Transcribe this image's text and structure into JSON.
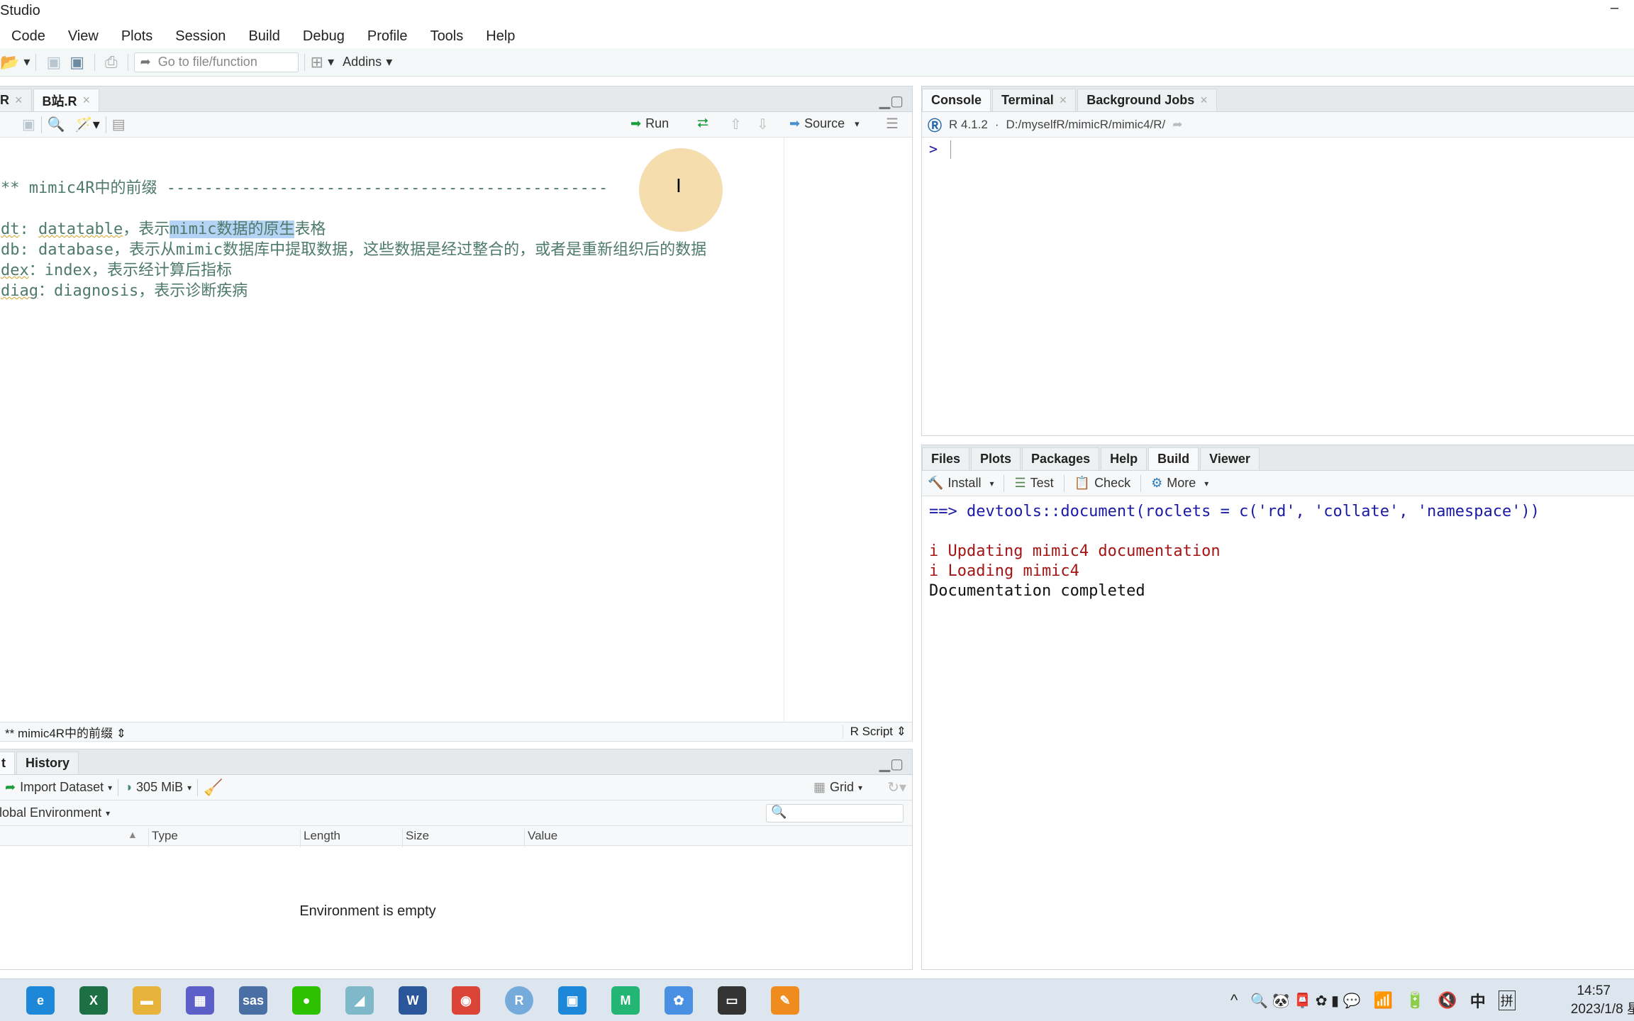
{
  "window": {
    "title": "Studio",
    "minimize": "–"
  },
  "menu": [
    "Code",
    "View",
    "Plots",
    "Session",
    "Build",
    "Debug",
    "Profile",
    "Tools",
    "Help"
  ],
  "toolbar": {
    "goto_placeholder": "Go to file/function",
    "addins": "Addins"
  },
  "editor": {
    "tabs": [
      {
        "label": "R",
        "active": false
      },
      {
        "label": "B站.R",
        "active": true
      }
    ],
    "run": "Run",
    "source": "Source",
    "lines": [
      {
        "parts": [
          [
            "** mimic4R中的前缀 ",
            "n"
          ],
          [
            "-----------------------------------------------",
            "n"
          ]
        ]
      },
      {
        "parts": []
      },
      {
        "parts": [
          [
            "dt",
            "sq"
          ],
          [
            ": ",
            "n"
          ],
          [
            "datatable",
            "sq"
          ],
          [
            "，表示",
            "n"
          ],
          [
            "mimic数据的原生",
            "sel"
          ],
          [
            "表格",
            "n"
          ]
        ]
      },
      {
        "parts": [
          [
            "db: database，表示从mimic数据库中提取数据，这些数据是经过整合的，或者是重新组织后的数据",
            "n"
          ]
        ]
      },
      {
        "parts": [
          [
            "dex",
            "sq"
          ],
          [
            "：index，表示经计算后指标",
            "n"
          ]
        ]
      },
      {
        "parts": [
          [
            "diag",
            "sq"
          ],
          [
            "：diagnosis，表示诊断疾病",
            "n"
          ]
        ]
      }
    ],
    "status_section": "** mimic4R中的前缀",
    "file_type": "R Script"
  },
  "environment": {
    "tabs": [
      {
        "label": "t",
        "active": true
      },
      {
        "label": "History",
        "active": false
      }
    ],
    "import": "Import Dataset",
    "memory": "305 MiB",
    "view": "Grid",
    "scope": "lobal Environment",
    "columns": [
      "Type",
      "Length",
      "Size",
      "Value"
    ],
    "empty": "Environment is empty"
  },
  "console": {
    "tabs": [
      {
        "label": "Console",
        "active": true,
        "closable": false
      },
      {
        "label": "Terminal",
        "active": false,
        "closable": true
      },
      {
        "label": "Background Jobs",
        "active": false,
        "closable": true
      }
    ],
    "r_version": "R 4.1.2",
    "separator": "·",
    "path": "D:/myselfR/mimicR/mimic4/R/",
    "prompt": ">"
  },
  "build": {
    "tabs": [
      {
        "label": "Files",
        "active": false
      },
      {
        "label": "Plots",
        "active": false
      },
      {
        "label": "Packages",
        "active": false
      },
      {
        "label": "Help",
        "active": false
      },
      {
        "label": "Build",
        "active": true
      },
      {
        "label": "Viewer",
        "active": false
      }
    ],
    "buttons": [
      "Install",
      "Test",
      "Check",
      "More"
    ],
    "output": [
      {
        "text": "==> devtools::document(roclets = c('rd', 'collate', 'namespace'))",
        "color": "#1a1aa6"
      },
      {
        "text": "",
        "color": "#000"
      },
      {
        "text": "i Updating mimic4 documentation",
        "color": "#a31515"
      },
      {
        "text": "i Loading mimic4",
        "color": "#a31515"
      },
      {
        "text": "Documentation completed",
        "color": "#111111"
      }
    ]
  },
  "taskbar": {
    "apps": [
      {
        "name": "edge",
        "glyph": "e",
        "color": "#1e88d8"
      },
      {
        "name": "excel",
        "glyph": "X",
        "color": "#1d7044"
      },
      {
        "name": "file-explorer",
        "glyph": "▬",
        "color": "#e8b33a"
      },
      {
        "name": "calendar",
        "glyph": "▦",
        "color": "#5b5fc7"
      },
      {
        "name": "sas",
        "glyph": "sas",
        "color": "#4a6fa5"
      },
      {
        "name": "wechat",
        "glyph": "●",
        "color": "#2dc100"
      },
      {
        "name": "notes",
        "glyph": "◢",
        "color": "#7fb8c9"
      },
      {
        "name": "word",
        "glyph": "W",
        "color": "#2b579a"
      },
      {
        "name": "chrome",
        "glyph": "◉",
        "color": "#db4437"
      },
      {
        "name": "rstudio",
        "glyph": "R",
        "color": "#75aadb"
      },
      {
        "name": "app-orange",
        "glyph": "▣",
        "color": "#1e88d8"
      },
      {
        "name": "xmind",
        "glyph": "M",
        "color": "#22b573"
      },
      {
        "name": "baidu-netdisk",
        "glyph": "✿",
        "color": "#4a90e2"
      },
      {
        "name": "remote-desktop",
        "glyph": "▭",
        "color": "#333333"
      },
      {
        "name": "pdf-editor",
        "glyph": "✎",
        "color": "#f08c1e"
      }
    ],
    "tray": [
      "^",
      "拼",
      "中",
      "🔇"
    ],
    "time": "14:57",
    "date": "2023/1/8 星"
  }
}
